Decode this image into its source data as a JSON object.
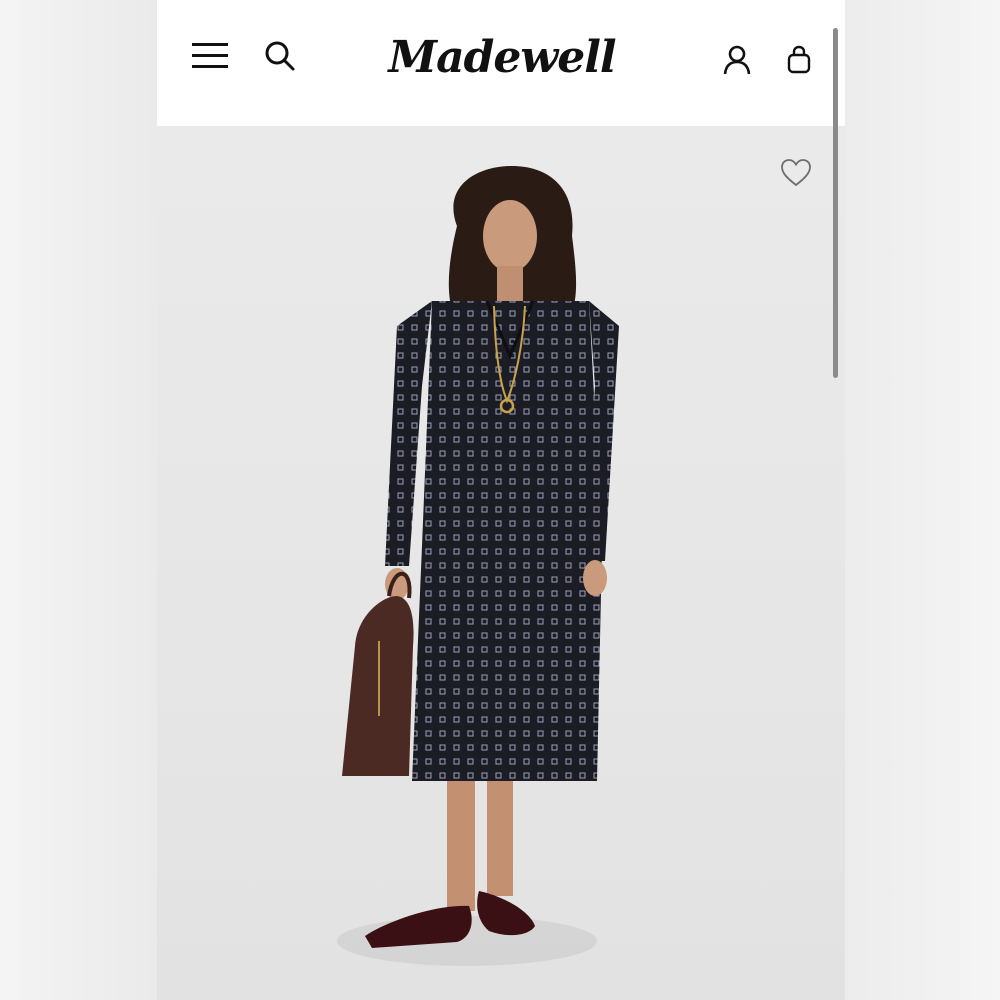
{
  "header": {
    "logo_text": "Madewell",
    "menu_icon": "hamburger-menu-icon",
    "search_icon": "search-icon",
    "account_icon": "account-icon",
    "bag_icon": "shopping-bag-icon"
  },
  "product": {
    "favorite_icon": "heart-icon",
    "image_alt_subject": "model-in-printed-shirt-dress",
    "colors": {
      "dress": "#1b1c24",
      "bag": "#4a2a22",
      "shoes": "#3a1014",
      "background": "#e7e7e7"
    }
  }
}
